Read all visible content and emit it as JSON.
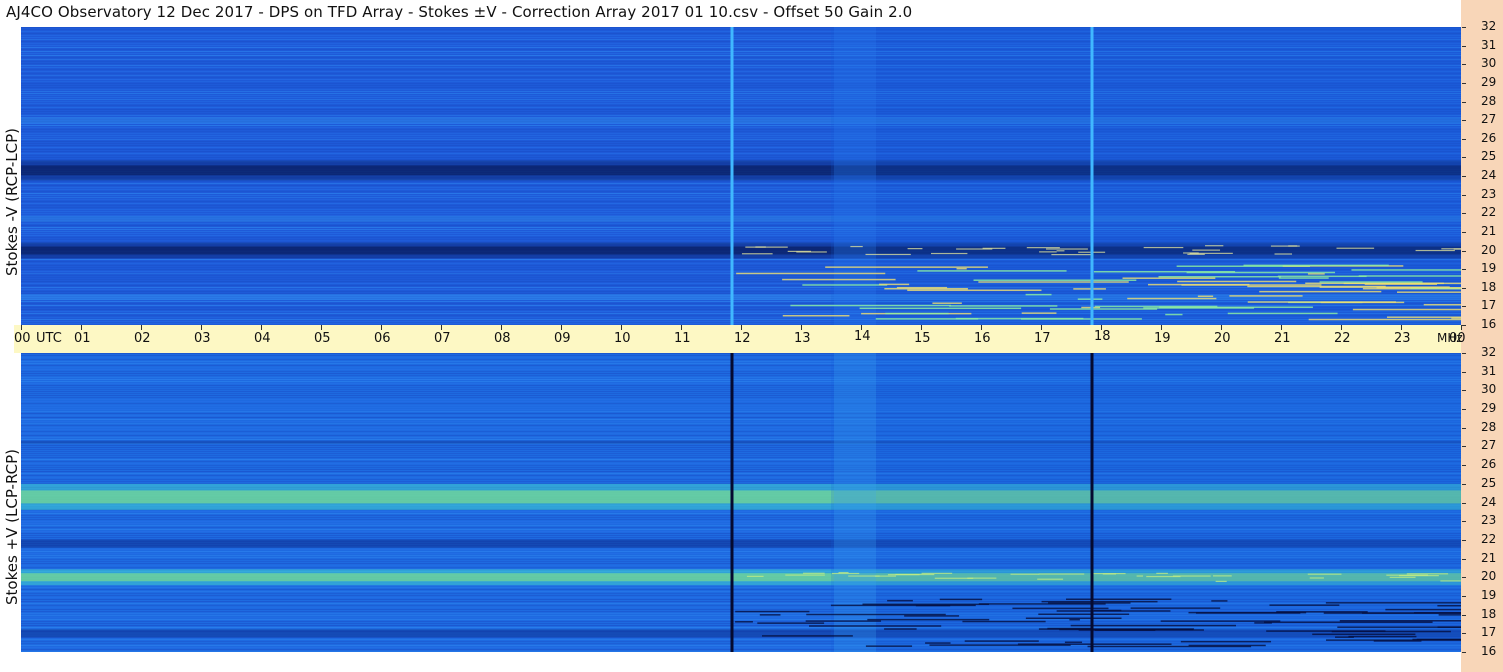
{
  "title": "AJ4CO Observatory  12 Dec 2017  -  DPS on TFD Array  -  Stokes ±V  -  Correction Array 2017 01 10.csv  -  Offset 50  Gain 2.0",
  "chart_data": [
    {
      "type": "heatmap",
      "title": "Stokes -V (RCP-LCP)",
      "ylabel": "Stokes -V (RCP-LCP)",
      "x_ticks": [
        "00",
        "01",
        "02",
        "03",
        "04",
        "05",
        "06",
        "07",
        "08",
        "09",
        "10",
        "11",
        "12",
        "13",
        "14",
        "15",
        "16",
        "17",
        "18",
        "19",
        "20",
        "21",
        "22",
        "23",
        "00"
      ],
      "x_unit": "UTC",
      "y_ticks": [
        16,
        17,
        18,
        19,
        20,
        21,
        22,
        23,
        24,
        25,
        26,
        27,
        28,
        29,
        30,
        31,
        32
      ],
      "y_unit": "MHz",
      "xlim": [
        0,
        24
      ],
      "ylim": [
        16,
        32
      ],
      "base_color": "#1e5ad8",
      "dark_bands_mhz": [
        24.3,
        20.0
      ],
      "vertical_lines_utc": [
        11.85,
        17.85
      ],
      "vertical_line_color": "#40b8ff"
    },
    {
      "type": "heatmap",
      "title": "Stokes +V (LCP-RCP)",
      "ylabel": "Stokes +V (LCP-RCP)",
      "x_ticks": [
        "00",
        "01",
        "02",
        "03",
        "04",
        "05",
        "06",
        "07",
        "08",
        "09",
        "10",
        "11",
        "12",
        "13",
        "14",
        "15",
        "16",
        "17",
        "18",
        "19",
        "20",
        "21",
        "22",
        "23",
        "00"
      ],
      "x_unit": "UTC",
      "y_ticks": [
        16,
        17,
        18,
        19,
        20,
        21,
        22,
        23,
        24,
        25,
        26,
        27,
        28,
        29,
        30,
        31,
        32
      ],
      "y_unit": "MHz",
      "xlim": [
        0,
        24
      ],
      "ylim": [
        16,
        32
      ],
      "base_color": "#1e6ae0",
      "bright_bands_mhz": [
        24.3,
        20.0
      ],
      "vertical_lines_utc": [
        11.85,
        17.85
      ],
      "vertical_line_color": "#050a30"
    }
  ],
  "time_axis": {
    "labels": [
      "00",
      "01",
      "02",
      "03",
      "04",
      "05",
      "06",
      "07",
      "08",
      "09",
      "10",
      "11",
      "12",
      "13",
      "14",
      "15",
      "16",
      "17",
      "18",
      "19",
      "20",
      "21",
      "22",
      "23",
      "00"
    ],
    "utc_label": "UTC",
    "mhz_label": "MHz"
  }
}
